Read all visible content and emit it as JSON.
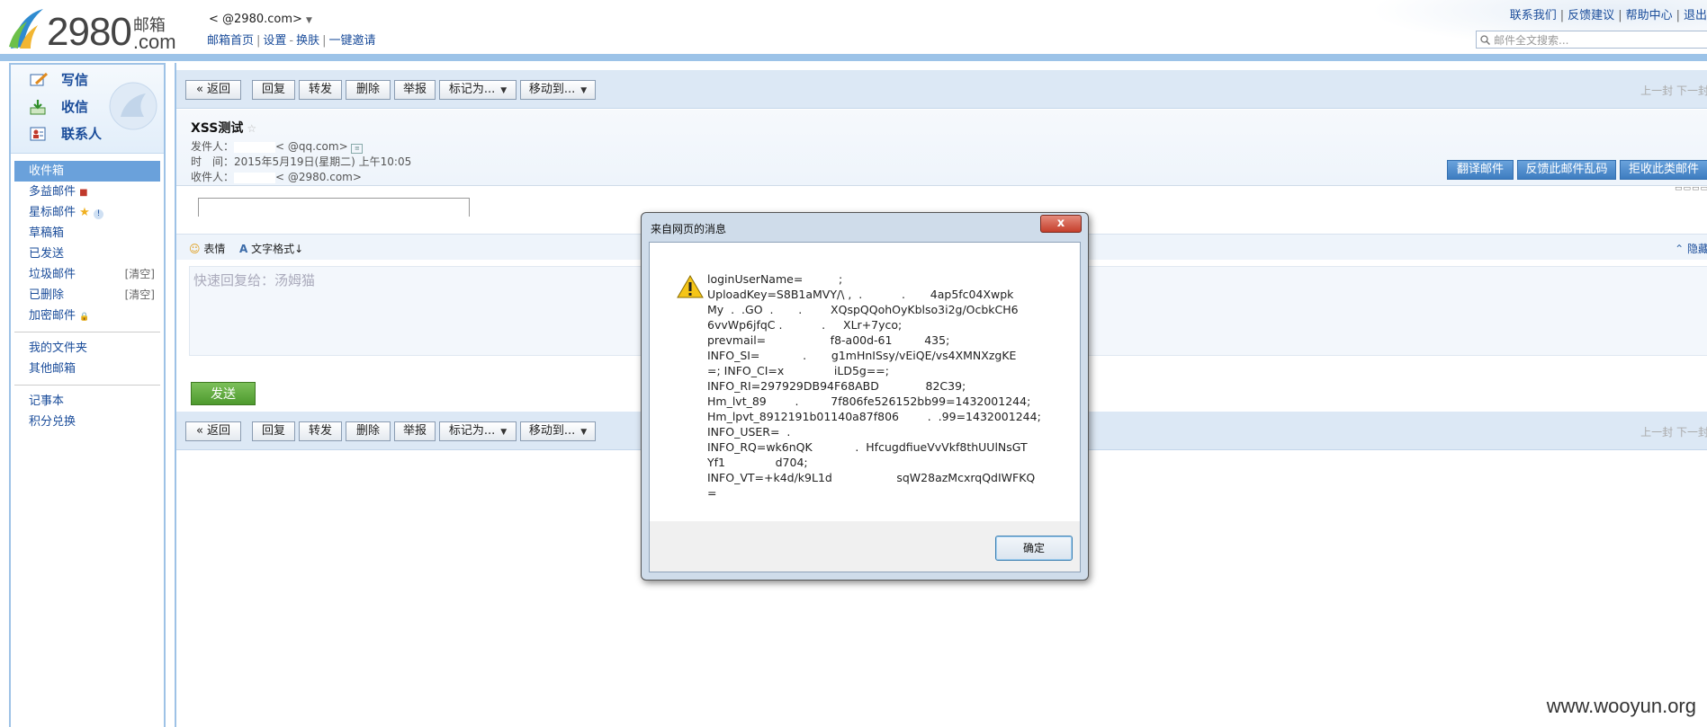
{
  "header": {
    "logo_number": "2980",
    "logo_mailbox": "邮箱",
    "logo_com": ".com",
    "account": "<          @2980.com>",
    "account_dropdown": "▼",
    "links": [
      "邮箱首页",
      "设置",
      "换肤",
      "一键邀请"
    ],
    "top_links": [
      "联系我们",
      "反馈建议",
      "帮助中心",
      "退出"
    ],
    "search_placeholder": "邮件全文搜索..."
  },
  "sidebar": {
    "quick": [
      {
        "label": "写信",
        "icon": "compose-icon"
      },
      {
        "label": "收信",
        "icon": "inbox-download-icon"
      },
      {
        "label": "联系人",
        "icon": "contacts-icon"
      }
    ],
    "folders": [
      {
        "label": "收件箱",
        "active": true
      },
      {
        "label": "多益邮件"
      },
      {
        "label": "星标邮件"
      },
      {
        "label": "草稿箱"
      },
      {
        "label": "已发送"
      },
      {
        "label": "垃圾邮件",
        "action": "[清空]"
      },
      {
        "label": "已删除",
        "action": "[清空]"
      },
      {
        "label": "加密邮件"
      }
    ],
    "folders2": [
      {
        "label": "我的文件夹"
      },
      {
        "label": "其他邮箱"
      }
    ],
    "folders3": [
      {
        "label": "记事本"
      },
      {
        "label": "积分兑换"
      }
    ]
  },
  "toolbar": {
    "back": "« 返回",
    "reply": "回复",
    "forward": "转发",
    "delete": "删除",
    "report": "举报",
    "mark": "标记为...",
    "move": "移动到...",
    "pager": "上一封  下一封"
  },
  "mail": {
    "subject": "XSS测试",
    "from_label": "发件人：",
    "from_value": "<          @qq.com>",
    "time_label": "时　间：",
    "time_value": "2015年5月19日(星期二) 上午10:05",
    "to_label": "收件人：",
    "to_value": "<          @2980.com>",
    "buttons": [
      "翻译邮件",
      "反馈此邮件乱码",
      "拒收此类邮件"
    ]
  },
  "editor": {
    "emoji": "表情",
    "format": "文字格式↓",
    "hide": "隐藏",
    "placeholder": "快速回复给：汤姆猫",
    "send": "发送"
  },
  "dialog": {
    "title": "来自网页的消息",
    "close": "x",
    "message": "loginUserName=          ;\nUploadKey=S8B1aMVY/\\ ,  .           .       4ap5fc04Xwpk\nMy  .  .GO  .       .        XQspQQohOyKblso3i2g/OcbkCH6\n6vvWp6jfqC .           .     XLr+7yco;\nprevmail=                  f8-a00d-61         435;\nINFO_SI=            .       g1mHnISsy/vEiQE/vs4XMNXzgKE\n=; INFO_CI=x              iLD5g==;\nINFO_RI=297929DB94F68ABD             82C39;\nHm_lvt_89        .         7f806fe526152bb99=1432001244;\nHm_lpvt_8912191b01140a87f806        .  .99=1432001244;\nINFO_USER=  .\nINFO_RQ=wk6nQK            .  HfcugdfiueVvVkf8thUUlNsGT\nYf1              d704;\nINFO_VT=+k4d/k9L1d                  sqW28azMcxrqQdIWFKQ\n=",
    "ok": "确定"
  },
  "watermark": "www.wooyun.org",
  "colors": {
    "accent": "#3d7cc0",
    "sidebar_border": "#9ec2e6",
    "send_green": "#4e9a2e",
    "close_red": "#c53f2c"
  }
}
